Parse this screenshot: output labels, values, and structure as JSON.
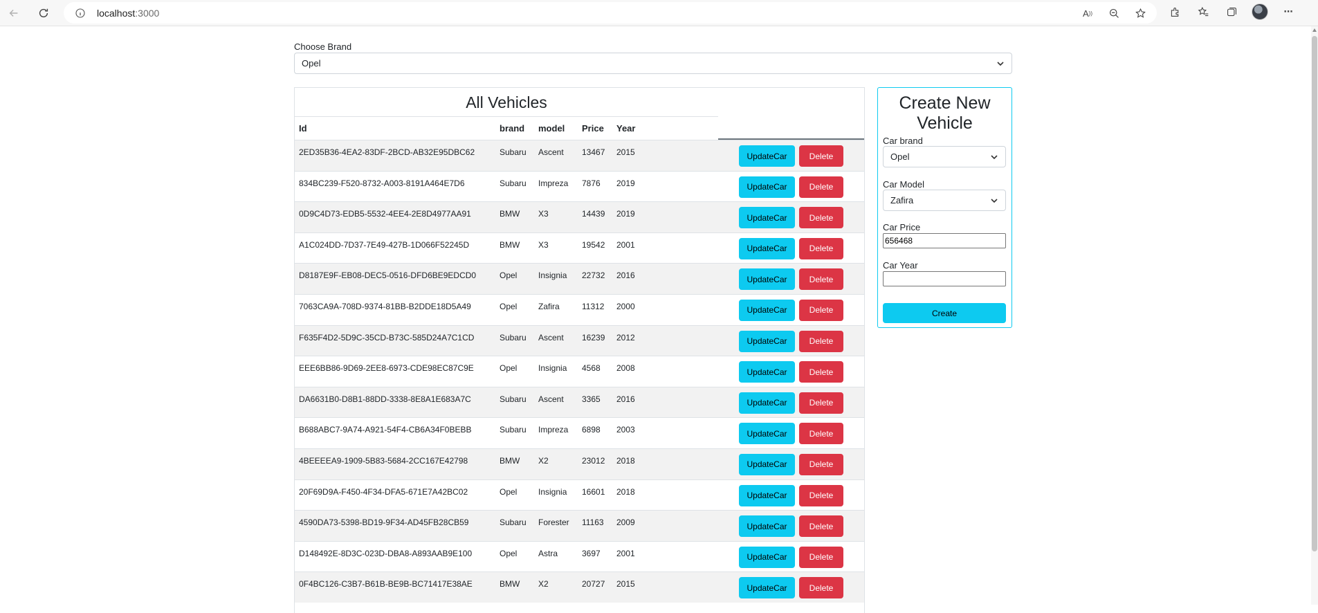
{
  "browser": {
    "url_host": "localhost",
    "url_port": ":3000",
    "font_size_icon": "Â"
  },
  "filter": {
    "label": "Choose Brand",
    "selected": "Opel"
  },
  "table": {
    "title": "All Vehicles",
    "columns": [
      "Id",
      "brand",
      "model",
      "Price",
      "Year"
    ],
    "update_label": "UpdateCar",
    "delete_label": "Delete",
    "rows": [
      {
        "id": "2ED35B36-4EA2-83DF-2BCD-AB32E95DBC62",
        "brand": "Subaru",
        "model": "Ascent",
        "price": "13467",
        "year": "2015"
      },
      {
        "id": "834BC239-F520-8732-A003-8191A464E7D6",
        "brand": "Subaru",
        "model": "Impreza",
        "price": "7876",
        "year": "2019"
      },
      {
        "id": "0D9C4D73-EDB5-5532-4EE4-2E8D4977AA91",
        "brand": "BMW",
        "model": "X3",
        "price": "14439",
        "year": "2019"
      },
      {
        "id": "A1C024DD-7D37-7E49-427B-1D066F52245D",
        "brand": "BMW",
        "model": "X3",
        "price": "19542",
        "year": "2001"
      },
      {
        "id": "D8187E9F-EB08-DEC5-0516-DFD6BE9EDCD0",
        "brand": "Opel",
        "model": "Insignia",
        "price": "22732",
        "year": "2016"
      },
      {
        "id": "7063CA9A-708D-9374-81BB-B2DDE18D5A49",
        "brand": "Opel",
        "model": "Zafira",
        "price": "11312",
        "year": "2000"
      },
      {
        "id": "F635F4D2-5D9C-35CD-B73C-585D24A7C1CD",
        "brand": "Subaru",
        "model": "Ascent",
        "price": "16239",
        "year": "2012"
      },
      {
        "id": "EEE6BB86-9D69-2EE8-6973-CDE98EC87C9E",
        "brand": "Opel",
        "model": "Insignia",
        "price": "4568",
        "year": "2008"
      },
      {
        "id": "DA6631B0-D8B1-88DD-3338-8E8A1E683A7C",
        "brand": "Subaru",
        "model": "Ascent",
        "price": "3365",
        "year": "2016"
      },
      {
        "id": "B688ABC7-9A74-A921-54F4-CB6A34F0BEBB",
        "brand": "Subaru",
        "model": "Impreza",
        "price": "6898",
        "year": "2003"
      },
      {
        "id": "4BEEEEA9-1909-5B83-5684-2CC167E42798",
        "brand": "BMW",
        "model": "X2",
        "price": "23012",
        "year": "2018"
      },
      {
        "id": "20F69D9A-F450-4F34-DFA5-671E7A42BC02",
        "brand": "Opel",
        "model": "Insignia",
        "price": "16601",
        "year": "2018"
      },
      {
        "id": "4590DA73-5398-BD19-9F34-AD45FB28CB59",
        "brand": "Subaru",
        "model": "Forester",
        "price": "11163",
        "year": "2009"
      },
      {
        "id": "D148492E-8D3C-023D-DBA8-A893AAB9E100",
        "brand": "Opel",
        "model": "Astra",
        "price": "3697",
        "year": "2001"
      },
      {
        "id": "0F4BC126-C3B7-B61B-BE9B-BC71417E38AE",
        "brand": "BMW",
        "model": "X2",
        "price": "20727",
        "year": "2015"
      }
    ]
  },
  "create": {
    "title": "Create New Vehicle",
    "brand_label": "Car brand",
    "brand_value": "Opel",
    "model_label": "Car Model",
    "model_value": "Zafira",
    "price_label": "Car Price",
    "price_value": "656468",
    "year_label": "Car Year",
    "year_value": "",
    "submit_label": "Create"
  },
  "colors": {
    "info": "#0dcaf0",
    "danger": "#dc3545",
    "stripe": "#f2f2f2"
  }
}
